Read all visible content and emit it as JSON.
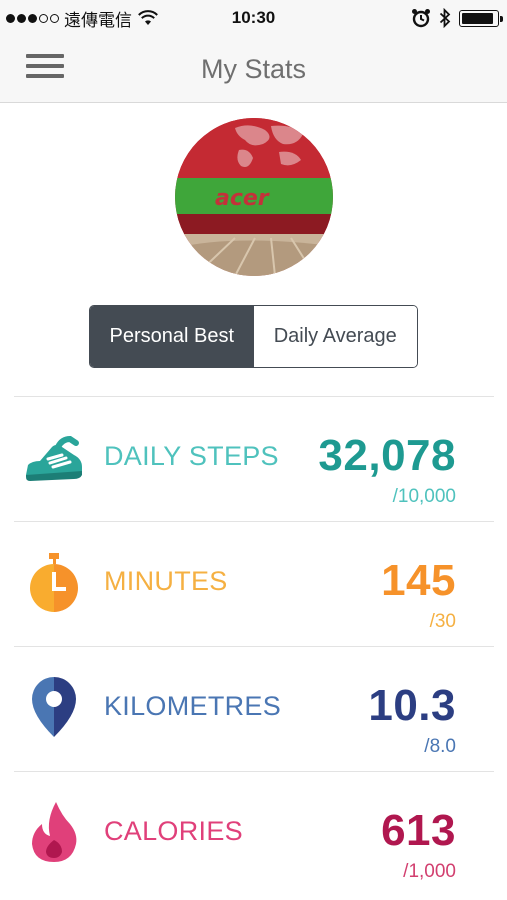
{
  "status_bar": {
    "carrier": "遠傳電信",
    "time": "10:30",
    "signal_bars_filled": 3,
    "signal_bars_total": 5,
    "icons": [
      "wifi-icon",
      "alarm-icon",
      "bluetooth-icon",
      "battery-icon"
    ],
    "battery_level": 0.9
  },
  "nav": {
    "title": "My Stats",
    "menu_icon": "hamburger-menu-icon"
  },
  "segment": {
    "options": [
      "Personal Best",
      "Daily Average"
    ],
    "selected": "Personal Best"
  },
  "stats": [
    {
      "id": "steps",
      "label": "DAILY STEPS",
      "value": "32,078",
      "goal": "/10,000",
      "icon": "shoe-icon",
      "label_color": "#4fc2bd",
      "value_color": "#1e9a91",
      "goal_color": "#4fc2bd"
    },
    {
      "id": "minutes",
      "label": "MINUTES",
      "value": "145",
      "goal": "/30",
      "icon": "stopwatch-icon",
      "label_color": "#f5b042",
      "value_color": "#f6922a",
      "goal_color": "#f5b042"
    },
    {
      "id": "kilometres",
      "label": "KILOMETRES",
      "value": "10.3",
      "goal": "/8.0",
      "icon": "map-pin-icon",
      "label_color": "#4a76b3",
      "value_color": "#2c3e82",
      "goal_color": "#4a76b3"
    },
    {
      "id": "calories",
      "label": "CALORIES",
      "value": "613",
      "goal": "/1,000",
      "icon": "flame-icon",
      "label_color": "#e0407a",
      "value_color": "#b0174f",
      "goal_color": "#d23f6f"
    }
  ],
  "colors": {
    "segment_active_bg": "#444b53",
    "nav_bg": "#f7f7f7"
  }
}
